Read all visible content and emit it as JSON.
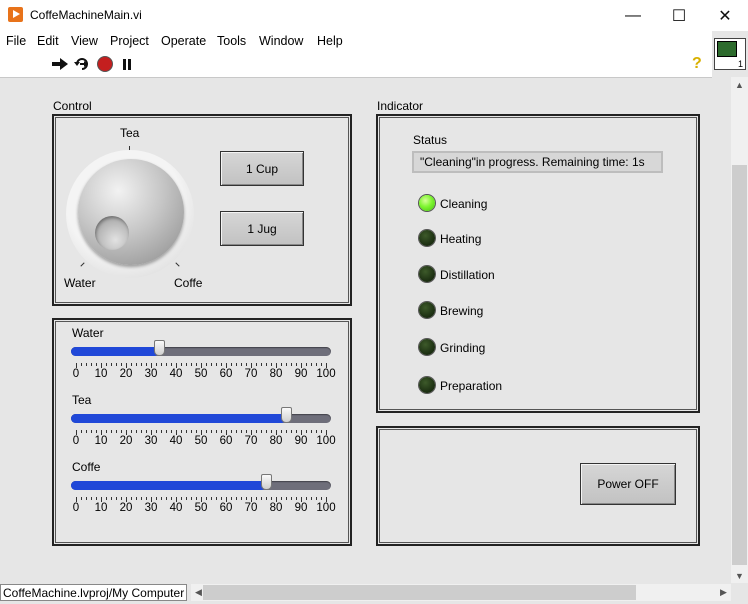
{
  "window": {
    "title": "CoffeMachineMain.vi",
    "minimize_glyph": "—",
    "maximize_glyph": "☐",
    "close_glyph": "✕"
  },
  "menu": [
    "File",
    "Edit",
    "View",
    "Project",
    "Operate",
    "Tools",
    "Window",
    "Help"
  ],
  "toolbar": {
    "vi_icon_number": "1",
    "help_glyph": "?"
  },
  "control": {
    "label": "Control",
    "knob": {
      "options": [
        "Tea",
        "Water",
        "Coffe"
      ],
      "label_tea": "Tea",
      "label_water": "Water",
      "label_coffe": "Coffe"
    },
    "buttons": {
      "cup": "1 Cup",
      "jug": "1 Jug"
    },
    "sliders": [
      {
        "label": "Water",
        "value": 33
      },
      {
        "label": "Tea",
        "value": 84
      },
      {
        "label": "Coffe",
        "value": 76
      }
    ],
    "scale": [
      "0",
      "10",
      "20",
      "30",
      "40",
      "50",
      "60",
      "70",
      "80",
      "90",
      "100"
    ]
  },
  "indicator": {
    "label": "Indicator",
    "status_label": "Status",
    "status_text": "\"Cleaning\"in progress. Remaining time: 1s",
    "leds": [
      {
        "label": "Cleaning",
        "on": true
      },
      {
        "label": "Heating",
        "on": false
      },
      {
        "label": "Distillation",
        "on": false
      },
      {
        "label": "Brewing",
        "on": false
      },
      {
        "label": "Grinding",
        "on": false
      },
      {
        "label": "Preparation",
        "on": false
      }
    ]
  },
  "power_button": "Power OFF",
  "statusbar": {
    "context": "CoffeMachine.lvproj/My Computer"
  },
  "colors": {
    "slider_fill": "#2048d8",
    "led_on": "#7ef530",
    "led_off": "#1f3314",
    "accent_icon": "#e8731a"
  }
}
